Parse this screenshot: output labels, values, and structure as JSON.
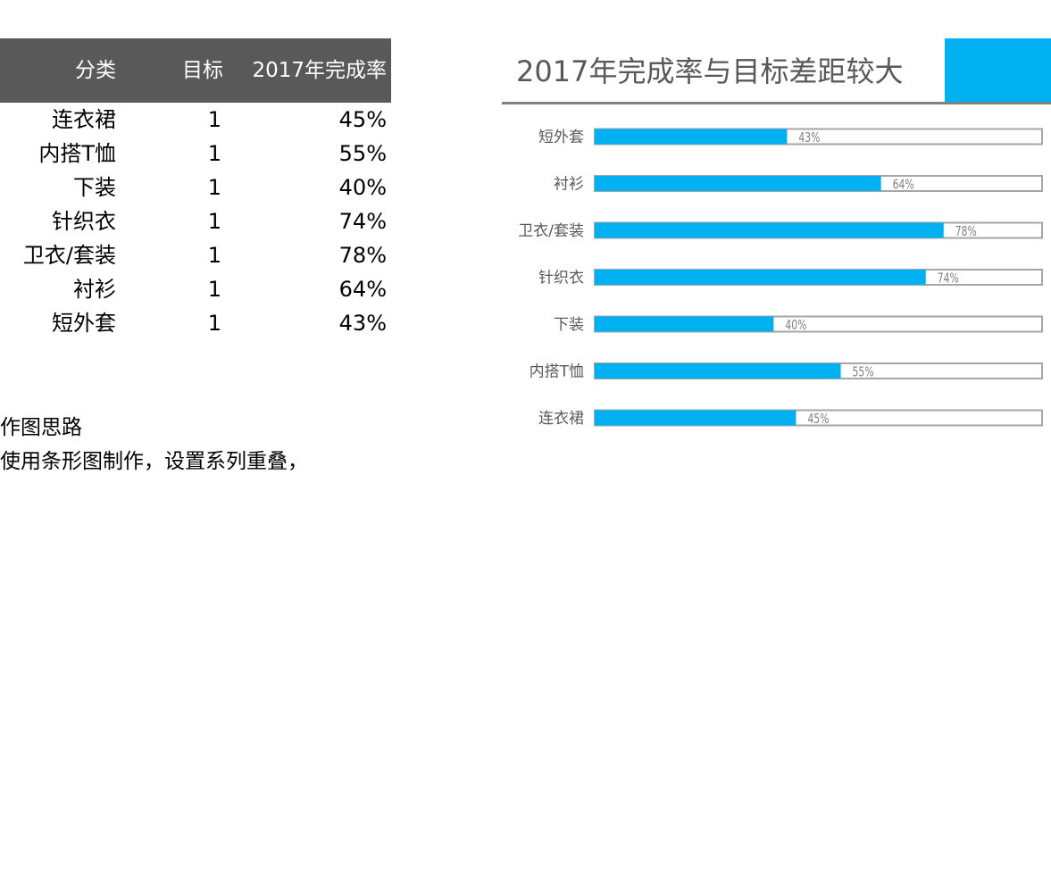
{
  "table": {
    "headers": {
      "category": "分类",
      "target": "目标",
      "rate": "2017年完成率"
    },
    "rows": [
      {
        "category": "连衣裙",
        "target": "1",
        "rate": "45%"
      },
      {
        "category": "内搭T恤",
        "target": "1",
        "rate": "55%"
      },
      {
        "category": "下装",
        "target": "1",
        "rate": "40%"
      },
      {
        "category": "针织衣",
        "target": "1",
        "rate": "74%"
      },
      {
        "category": "卫衣/套装",
        "target": "1",
        "rate": "78%"
      },
      {
        "category": "衬衫",
        "target": "1",
        "rate": "64%"
      },
      {
        "category": "短外套",
        "target": "1",
        "rate": "43%"
      }
    ]
  },
  "notes": {
    "heading": "作图思路",
    "body": "使用条形图制作，设置系列重叠，"
  },
  "colors": {
    "header_bg": "#595959",
    "accent": "#00B0F0",
    "track_border": "#A6A6A6",
    "rule": "#808080"
  },
  "chart_data": {
    "type": "bar",
    "orientation": "horizontal",
    "title": "2017年完成率与目标差距较大",
    "categories": [
      "短外套",
      "衬衫",
      "卫衣/套装",
      "针织衣",
      "下装",
      "内搭T恤",
      "连衣裙"
    ],
    "series": [
      {
        "name": "目标",
        "values": [
          1,
          1,
          1,
          1,
          1,
          1,
          1
        ],
        "style": "outline"
      },
      {
        "name": "2017年完成率",
        "values": [
          0.43,
          0.64,
          0.78,
          0.74,
          0.4,
          0.55,
          0.45
        ],
        "style": "fill"
      }
    ],
    "data_labels": [
      "43%",
      "64%",
      "78%",
      "74%",
      "40%",
      "55%",
      "45%"
    ],
    "xlim": [
      0,
      1
    ],
    "overlap": "100%",
    "grid": false,
    "legend": "none",
    "xlabel": "",
    "ylabel": ""
  }
}
